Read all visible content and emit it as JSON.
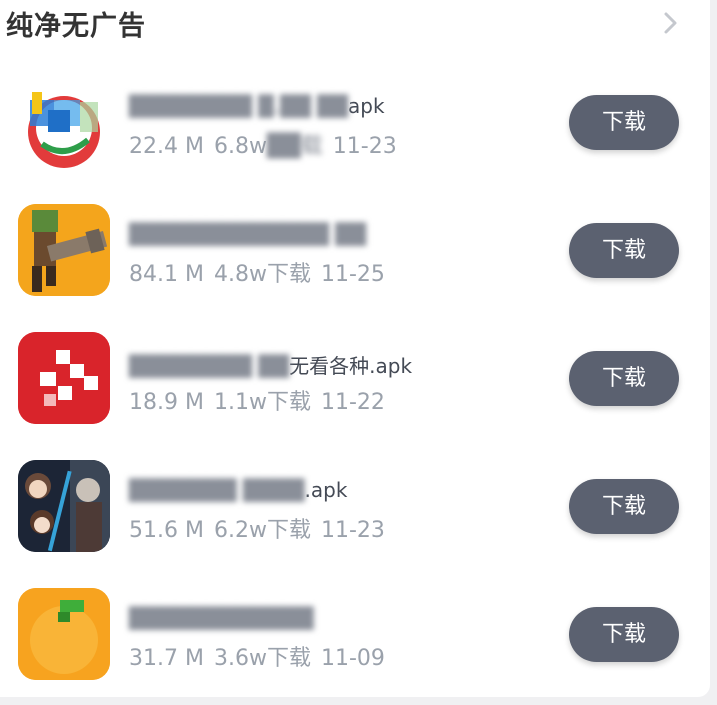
{
  "section": {
    "title": "纯净无广告",
    "more_icon": "chevron-right-icon"
  },
  "colors": {
    "button_bg": "#5b6170",
    "meta_text": "#9aa1ab"
  },
  "apps": [
    {
      "filename_visible": "apk",
      "size": "22.4 M",
      "downloads": "6.8w",
      "date": "11-23",
      "button": "下载",
      "icon": "news-app-icon"
    },
    {
      "filename_visible": "",
      "size": "84.1 M",
      "downloads": "4.8w下载",
      "date": "11-25",
      "button": "下载",
      "icon": "game-app-icon"
    },
    {
      "filename_visible": "无看各种.apk",
      "size": "18.9 M",
      "downloads": "1.1w下载",
      "date": "11-22",
      "button": "下载",
      "icon": "video-app-icon"
    },
    {
      "filename_visible": ".apk",
      "size": "51.6 M",
      "downloads": "6.2w下载",
      "date": "11-23",
      "button": "下载",
      "icon": "movie-app-icon"
    },
    {
      "filename_visible": "",
      "size": "31.7 M",
      "downloads": "3.6w下载",
      "date": "11-09",
      "button": "下载",
      "icon": "orange-app-icon"
    }
  ]
}
